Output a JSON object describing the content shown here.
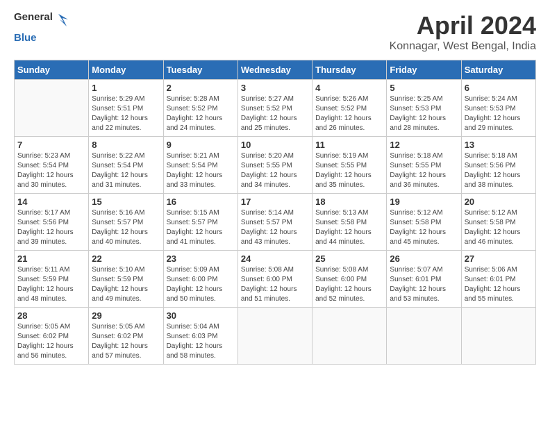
{
  "logo": {
    "text_general": "General",
    "text_blue": "Blue"
  },
  "title": "April 2024",
  "subtitle": "Konnagar, West Bengal, India",
  "headers": [
    "Sunday",
    "Monday",
    "Tuesday",
    "Wednesday",
    "Thursday",
    "Friday",
    "Saturday"
  ],
  "weeks": [
    [
      {
        "day": "",
        "info": ""
      },
      {
        "day": "1",
        "info": "Sunrise: 5:29 AM\nSunset: 5:51 PM\nDaylight: 12 hours\nand 22 minutes."
      },
      {
        "day": "2",
        "info": "Sunrise: 5:28 AM\nSunset: 5:52 PM\nDaylight: 12 hours\nand 24 minutes."
      },
      {
        "day": "3",
        "info": "Sunrise: 5:27 AM\nSunset: 5:52 PM\nDaylight: 12 hours\nand 25 minutes."
      },
      {
        "day": "4",
        "info": "Sunrise: 5:26 AM\nSunset: 5:52 PM\nDaylight: 12 hours\nand 26 minutes."
      },
      {
        "day": "5",
        "info": "Sunrise: 5:25 AM\nSunset: 5:53 PM\nDaylight: 12 hours\nand 28 minutes."
      },
      {
        "day": "6",
        "info": "Sunrise: 5:24 AM\nSunset: 5:53 PM\nDaylight: 12 hours\nand 29 minutes."
      }
    ],
    [
      {
        "day": "7",
        "info": "Sunrise: 5:23 AM\nSunset: 5:54 PM\nDaylight: 12 hours\nand 30 minutes."
      },
      {
        "day": "8",
        "info": "Sunrise: 5:22 AM\nSunset: 5:54 PM\nDaylight: 12 hours\nand 31 minutes."
      },
      {
        "day": "9",
        "info": "Sunrise: 5:21 AM\nSunset: 5:54 PM\nDaylight: 12 hours\nand 33 minutes."
      },
      {
        "day": "10",
        "info": "Sunrise: 5:20 AM\nSunset: 5:55 PM\nDaylight: 12 hours\nand 34 minutes."
      },
      {
        "day": "11",
        "info": "Sunrise: 5:19 AM\nSunset: 5:55 PM\nDaylight: 12 hours\nand 35 minutes."
      },
      {
        "day": "12",
        "info": "Sunrise: 5:18 AM\nSunset: 5:55 PM\nDaylight: 12 hours\nand 36 minutes."
      },
      {
        "day": "13",
        "info": "Sunrise: 5:18 AM\nSunset: 5:56 PM\nDaylight: 12 hours\nand 38 minutes."
      }
    ],
    [
      {
        "day": "14",
        "info": "Sunrise: 5:17 AM\nSunset: 5:56 PM\nDaylight: 12 hours\nand 39 minutes."
      },
      {
        "day": "15",
        "info": "Sunrise: 5:16 AM\nSunset: 5:57 PM\nDaylight: 12 hours\nand 40 minutes."
      },
      {
        "day": "16",
        "info": "Sunrise: 5:15 AM\nSunset: 5:57 PM\nDaylight: 12 hours\nand 41 minutes."
      },
      {
        "day": "17",
        "info": "Sunrise: 5:14 AM\nSunset: 5:57 PM\nDaylight: 12 hours\nand 43 minutes."
      },
      {
        "day": "18",
        "info": "Sunrise: 5:13 AM\nSunset: 5:58 PM\nDaylight: 12 hours\nand 44 minutes."
      },
      {
        "day": "19",
        "info": "Sunrise: 5:12 AM\nSunset: 5:58 PM\nDaylight: 12 hours\nand 45 minutes."
      },
      {
        "day": "20",
        "info": "Sunrise: 5:12 AM\nSunset: 5:58 PM\nDaylight: 12 hours\nand 46 minutes."
      }
    ],
    [
      {
        "day": "21",
        "info": "Sunrise: 5:11 AM\nSunset: 5:59 PM\nDaylight: 12 hours\nand 48 minutes."
      },
      {
        "day": "22",
        "info": "Sunrise: 5:10 AM\nSunset: 5:59 PM\nDaylight: 12 hours\nand 49 minutes."
      },
      {
        "day": "23",
        "info": "Sunrise: 5:09 AM\nSunset: 6:00 PM\nDaylight: 12 hours\nand 50 minutes."
      },
      {
        "day": "24",
        "info": "Sunrise: 5:08 AM\nSunset: 6:00 PM\nDaylight: 12 hours\nand 51 minutes."
      },
      {
        "day": "25",
        "info": "Sunrise: 5:08 AM\nSunset: 6:00 PM\nDaylight: 12 hours\nand 52 minutes."
      },
      {
        "day": "26",
        "info": "Sunrise: 5:07 AM\nSunset: 6:01 PM\nDaylight: 12 hours\nand 53 minutes."
      },
      {
        "day": "27",
        "info": "Sunrise: 5:06 AM\nSunset: 6:01 PM\nDaylight: 12 hours\nand 55 minutes."
      }
    ],
    [
      {
        "day": "28",
        "info": "Sunrise: 5:05 AM\nSunset: 6:02 PM\nDaylight: 12 hours\nand 56 minutes."
      },
      {
        "day": "29",
        "info": "Sunrise: 5:05 AM\nSunset: 6:02 PM\nDaylight: 12 hours\nand 57 minutes."
      },
      {
        "day": "30",
        "info": "Sunrise: 5:04 AM\nSunset: 6:03 PM\nDaylight: 12 hours\nand 58 minutes."
      },
      {
        "day": "",
        "info": ""
      },
      {
        "day": "",
        "info": ""
      },
      {
        "day": "",
        "info": ""
      },
      {
        "day": "",
        "info": ""
      }
    ]
  ]
}
